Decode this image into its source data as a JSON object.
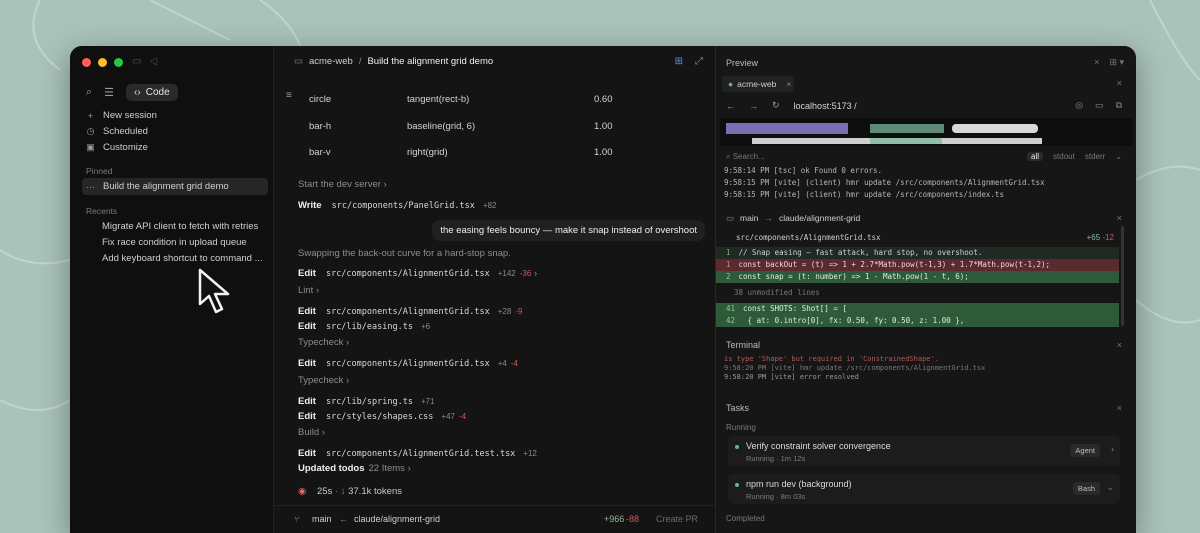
{
  "window": {
    "traffic_colors": [
      "#ff5f57",
      "#febc2e",
      "#28c840"
    ]
  },
  "sidebar": {
    "mode_label": "Code",
    "actions": [
      {
        "icon": "plus-icon",
        "label": "New session"
      },
      {
        "icon": "clock-icon",
        "label": "Scheduled"
      },
      {
        "icon": "customize-icon",
        "label": "Customize"
      }
    ],
    "pinned_heading": "Pinned",
    "pinned_item": "Build the alignment grid demo",
    "recents_heading": "Recents",
    "recents": [
      "Migrate API client to fetch with retries",
      "Fix race condition in upload queue",
      "Add keyboard shortcut to command ..."
    ]
  },
  "center": {
    "project": "acme-web",
    "separator": "/",
    "session_title": "Build the alignment grid demo",
    "table_rows": [
      {
        "name": "circle",
        "rule": "tangent(rect-b)",
        "value": "0.60"
      },
      {
        "name": "bar-h",
        "rule": "baseline(grid, 6)",
        "value": "1.00"
      },
      {
        "name": "bar-v",
        "rule": "right(grid)",
        "value": "1.00"
      }
    ],
    "start_dev": "Start the dev server",
    "write_verb": "Write",
    "write_path": "src/components/PanelGrid.tsx",
    "write_add": "+82",
    "user_message": "the easing feels bouncy — make it snap instead of overshoot",
    "assistant_line": "Swapping the back-out curve for a hard-stop snap.",
    "edit_verb": "Edit",
    "edits": [
      {
        "path": "src/components/AlignmentGrid.tsx",
        "add": "+142",
        "del": "-36"
      },
      {
        "step": "Lint"
      },
      {
        "path": "src/components/AlignmentGrid.tsx",
        "add": "+28",
        "del": "-9"
      },
      {
        "path": "src/lib/easing.ts",
        "add": "+6",
        "del": ""
      },
      {
        "step": "Typecheck"
      },
      {
        "path": "src/components/AlignmentGrid.tsx",
        "add": "+4",
        "del": "-4"
      },
      {
        "step": "Typecheck"
      },
      {
        "path": "src/lib/spring.ts",
        "add": "+71",
        "del": ""
      },
      {
        "path": "src/styles/shapes.css",
        "add": "+47",
        "del": "-4"
      },
      {
        "step": "Build"
      },
      {
        "path": "src/components/AlignmentGrid.test.tsx",
        "add": "+12",
        "del": ""
      }
    ],
    "todos_label": "Updated todos",
    "todos_count": "22 Items",
    "status_time": "25s",
    "status_tokens": "37.1k tokens",
    "branch_from": "main",
    "branch_to": "claude/alignment-grid",
    "diff_add": "+966",
    "diff_del": "-88",
    "create_pr": "Create PR"
  },
  "preview": {
    "title": "Preview",
    "tab": "acme-web",
    "url": "localhost:5173 /",
    "search_placeholder": "Search...",
    "log_tabs": [
      "all",
      "stdout",
      "stderr"
    ],
    "logs": [
      "9:58:14 PM [tsc] ok Found 0 errors.",
      "9:58:15 PM [vite] (client) hmr update /src/components/AlignmentGrid.tsx",
      "9:58:15 PM [vite] (client) hmr update /src/components/index.ts"
    ],
    "diff_branch_from": "main",
    "diff_branch_to": "claude/alignment-grid",
    "diff_file": "src/components/AlignmentGrid.tsx",
    "diff_stat_add": "+65",
    "diff_stat_del": "-12",
    "diff_lines": [
      {
        "kind": "ctx-add",
        "num": "1",
        "text": "// Snap easing — fast attack, hard stop, no overshoot."
      },
      {
        "kind": "del",
        "num": "1",
        "text": "const backOut = (t) => 1 + 2.7*Math.pow(t-1,3) + 1.7*Math.pow(t-1,2);"
      },
      {
        "kind": "add",
        "num": "2",
        "text": "const snap = (t: number) => 1 - Math.pow(1 - t, 6);"
      },
      {
        "kind": "ctx",
        "num": "",
        "text": "38 unmodified lines"
      },
      {
        "kind": "add",
        "num": "41",
        "text": "const SHOTS: Shot[] = ["
      },
      {
        "kind": "add",
        "num": "42",
        "text": "  { at: 0.intro[0],   fx: 0.50, fy: 0.50, z: 1.00 },"
      }
    ],
    "terminal_title": "Terminal",
    "terminal_lines": [
      "is type 'Shape' but required in 'ConstrainedShape'.",
      "9:58:20 PM [vite] hmr update /src/components/AlignmentGrid.tsx",
      "9:58:20 PM [vite] error resolved"
    ],
    "tasks_title": "Tasks",
    "running_label": "Running",
    "tasks": [
      {
        "title": "Verify constraint solver convergence",
        "sub": "Running · 1m 12s",
        "tag": "Agent"
      },
      {
        "title": "npm run dev (background)",
        "sub": "Running · 8m 03s",
        "tag": "Bash"
      }
    ],
    "completed_label": "Completed"
  }
}
